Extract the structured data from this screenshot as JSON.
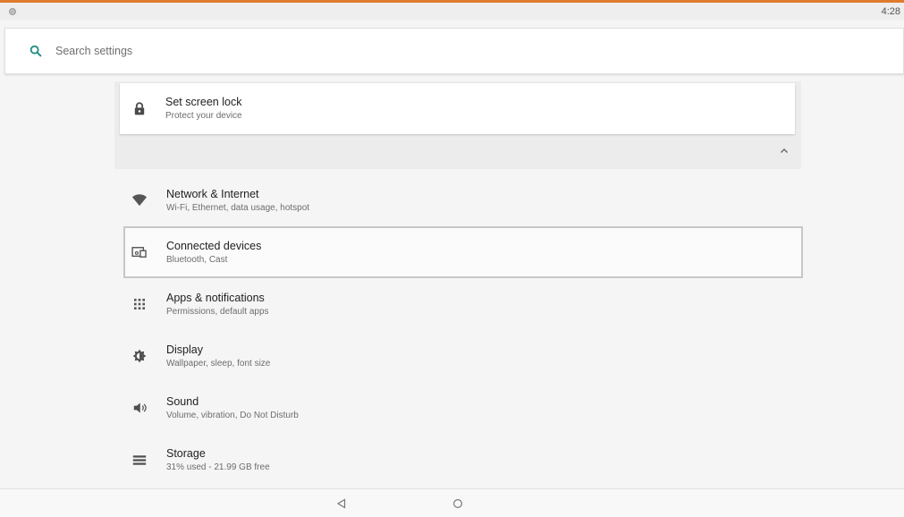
{
  "status_bar": {
    "time": "4:28",
    "indicator_icon": "status-dot-icon"
  },
  "search": {
    "placeholder": "Search settings",
    "icon": "search-icon"
  },
  "suggestion": {
    "title": "Set screen lock",
    "subtitle": "Protect your device",
    "icon": "lock-icon",
    "collapse_icon": "chevron-up-icon"
  },
  "settings": {
    "items": [
      {
        "title": "Network & Internet",
        "subtitle": "Wi-Fi, Ethernet, data usage, hotspot",
        "icon": "wifi-icon"
      },
      {
        "title": "Connected devices",
        "subtitle": "Bluetooth, Cast",
        "icon": "connected-devices-icon",
        "selected": true
      },
      {
        "title": "Apps & notifications",
        "subtitle": "Permissions, default apps",
        "icon": "apps-grid-icon"
      },
      {
        "title": "Display",
        "subtitle": "Wallpaper, sleep, font size",
        "icon": "brightness-icon"
      },
      {
        "title": "Sound",
        "subtitle": "Volume, vibration, Do Not Disturb",
        "icon": "volume-icon"
      },
      {
        "title": "Storage",
        "subtitle": "31% used - 21.99 GB free",
        "icon": "storage-icon"
      }
    ]
  },
  "navigation": {
    "back_icon": "back-triangle-icon",
    "home_icon": "home-circle-icon"
  },
  "colors": {
    "accent": "#e07a2c",
    "search_icon": "#1f8f83",
    "background": "#f5f5f5",
    "card": "#ffffff"
  }
}
